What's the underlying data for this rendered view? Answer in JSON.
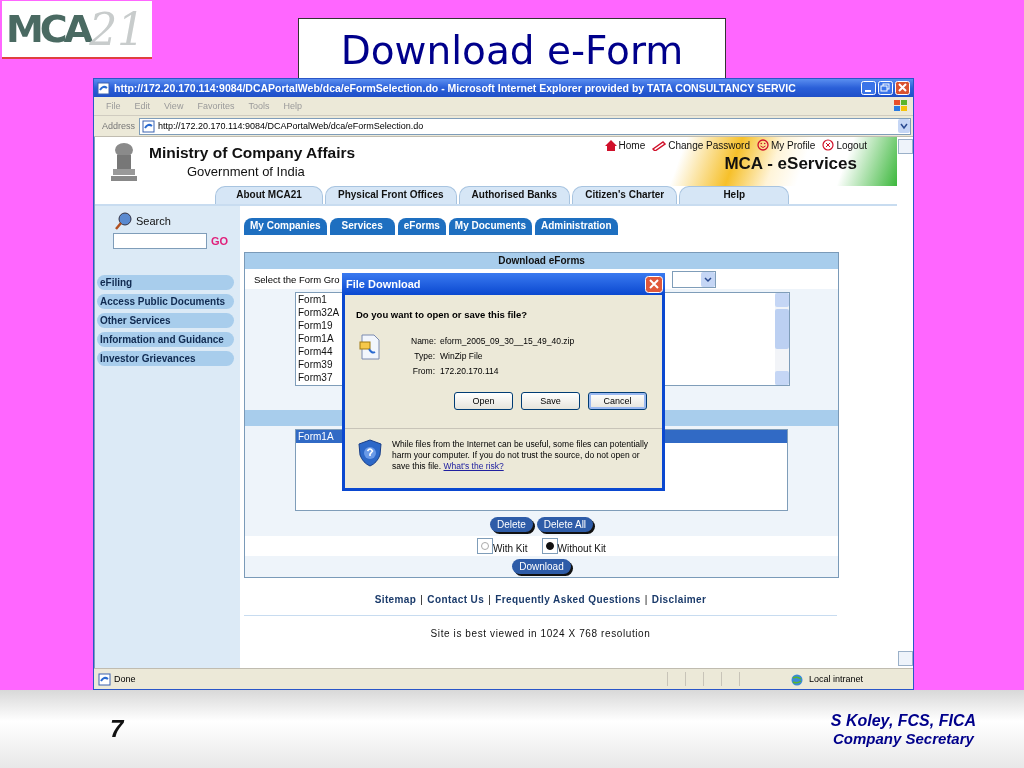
{
  "slide": {
    "logo": {
      "letters": "MCA",
      "number": "21"
    },
    "title": "Download e-Form",
    "page_number": "7",
    "author": "S Koley, FCS, FICA",
    "role": "Company Secretary"
  },
  "browser": {
    "title": "http://172.20.170.114:9084/DCAPortalWeb/dca/eFormSelection.do - Microsoft Internet Explorer provided by TATA CONSULTANCY SERVIC",
    "menu": [
      "File",
      "Edit",
      "View",
      "Favorites",
      "Tools",
      "Help"
    ],
    "address_label": "Address",
    "address": "http://172.20.170.114:9084/DCAPortalWeb/dca/eFormSelection.do",
    "status": "Done",
    "zone": "Local intranet"
  },
  "site": {
    "ministry": "Ministry of Company Affairs",
    "government": "Government of India",
    "banner": "MCA - eServices",
    "top_links": [
      {
        "kind": "home",
        "label": "Home"
      },
      {
        "kind": "password",
        "label": "Change Password"
      },
      {
        "kind": "profile",
        "label": "My Profile"
      },
      {
        "kind": "logout",
        "label": "Logout"
      }
    ],
    "top_tabs": [
      "About MCA21",
      "Physical Front Offices",
      "Authorised Banks",
      "Citizen's Charter",
      "Help"
    ],
    "search_label": "Search",
    "search_button": "GO",
    "sidebar": [
      "eFiling",
      "Access Public Documents",
      "Other Services",
      "Information and Guidance",
      "Investor Grievances"
    ],
    "tabs": [
      "My Companies",
      "Services",
      "eForms",
      "My Documents",
      "Administration"
    ]
  },
  "panel": {
    "title": "Download eForms",
    "group_label": "Select the Form Gro",
    "forms": [
      "Form1",
      "Form32A",
      "Form19",
      "Form1A",
      "Form44",
      "Form39",
      "Form37"
    ],
    "chosen_forms": [
      {
        "label": "Form1A",
        "selected": true
      }
    ],
    "buttons": [
      "Delete",
      "Delete All"
    ],
    "options": [
      {
        "label": "With Kit",
        "selected": false
      },
      {
        "label": "Without Kit",
        "selected": true
      }
    ],
    "download": "Download"
  },
  "footer_links": [
    {
      "kind": "link",
      "label": "Sitemap"
    },
    {
      "kind": "separator",
      "label": "|"
    },
    {
      "kind": "link",
      "label": "Contact Us"
    },
    {
      "kind": "separator",
      "label": "|"
    },
    {
      "kind": "link",
      "label": "Frequently Asked Questions"
    },
    {
      "kind": "separator",
      "label": "|"
    },
    {
      "kind": "link",
      "label": "Disclaimer"
    }
  ],
  "resolution_note": "Site is best viewed in 1024 X 768 resolution",
  "dialog": {
    "title": "File Download",
    "question": "Do you want to open or save this file?",
    "fields": [
      {
        "label": "Name:",
        "value": "eform_2005_09_30__15_49_40.zip"
      },
      {
        "label": "Type:",
        "value": "WinZip File"
      },
      {
        "label": "From:",
        "value": "172.20.170.114"
      }
    ],
    "buttons": [
      {
        "label": "Open",
        "selected": false
      },
      {
        "label": "Save",
        "selected": false
      },
      {
        "label": "Cancel",
        "selected": true
      }
    ],
    "warning": "While files from the Internet can be useful, some files can potentially harm your computer. If you do not trust the source, do not open or save this file.",
    "risk_link": "What's the risk?"
  }
}
